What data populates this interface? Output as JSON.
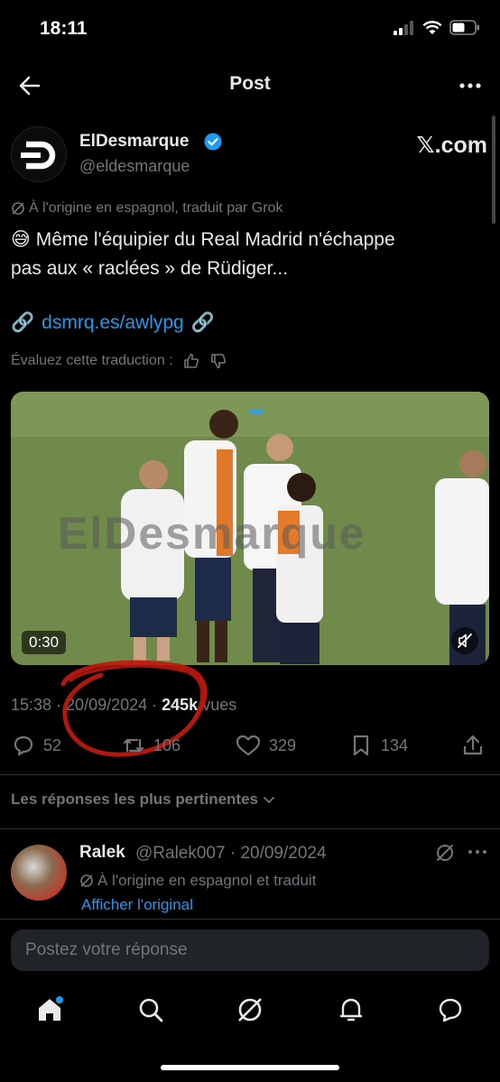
{
  "status_bar": {
    "time": "18:11"
  },
  "nav": {
    "title": "Post"
  },
  "post": {
    "author_name": "ElDesmarque",
    "author_handle": "@eldesmarque",
    "brand": "𝕏.com",
    "translated_note": "À l'origine en espagnol, traduit par Grok",
    "emoji": "😅",
    "text_line1": "Même l'équipier du Real Madrid n'échappe",
    "text_line2": "pas aux « raclées » de Rüdiger...",
    "link_emoji": "🔗",
    "link_text": "dsmrq.es/awlypg",
    "rate_translation": "Évaluez cette traduction :",
    "media": {
      "watermark": "ElDesmarque",
      "duration": "0:30"
    },
    "time": "15:38",
    "date": "20/09/2024",
    "views_count": "245k",
    "views_label": "vues",
    "stats": {
      "replies": "52",
      "reposts": "106",
      "likes": "329",
      "bookmarks": "134"
    }
  },
  "replies_sort": "Les réponses les plus pertinentes",
  "reply": {
    "name": "Ralek",
    "handle_date": "@Ralek007 · 20/09/2024",
    "translated_note": "À l'origine en espagnol et traduit",
    "show_original": "Afficher l'original"
  },
  "composer": {
    "placeholder": "Postez votre réponse"
  },
  "colors": {
    "accent": "#1d9bf0",
    "muted": "#71767b",
    "background": "#000000",
    "annotation": "#c0190f"
  }
}
